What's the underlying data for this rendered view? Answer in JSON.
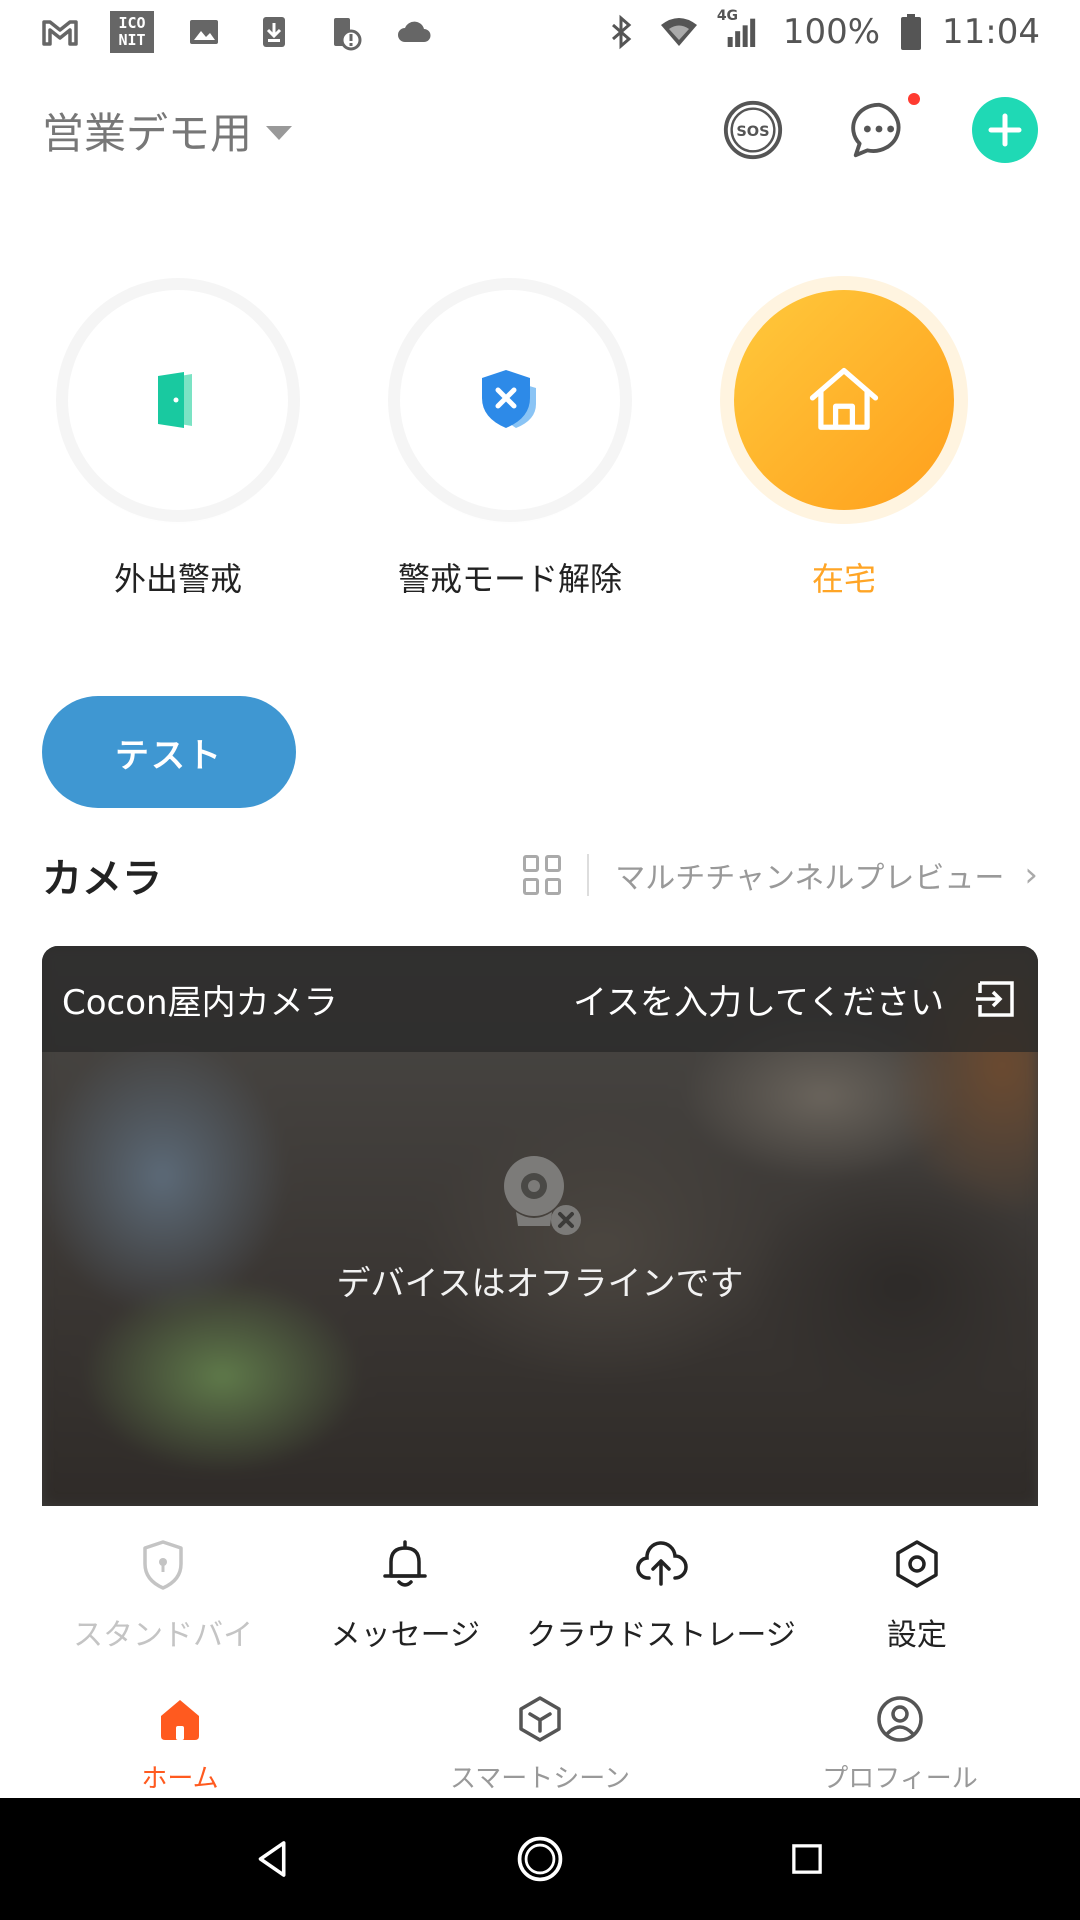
{
  "status_bar": {
    "battery": "100%",
    "time": "11:04",
    "network": "4G",
    "iconit_text": "ICO NIT"
  },
  "header": {
    "home_name": "営業デモ用"
  },
  "modes": [
    {
      "label": "外出警戒",
      "active": false
    },
    {
      "label": "警戒モード解除",
      "active": false
    },
    {
      "label": "在宅",
      "active": true
    }
  ],
  "test_button": "テスト",
  "camera_section": {
    "title": "カメラ",
    "multi_preview": "マルチチャンネルプレビュー"
  },
  "camera_card": {
    "name": "Cocon屋内カメラ",
    "marquee": "イスを入力してください",
    "offline_text": "デバイスはオフラインです"
  },
  "quick_actions": [
    {
      "label": "スタンドバイ",
      "icon": "shield-icon",
      "enabled": false
    },
    {
      "label": "メッセージ",
      "icon": "bell-icon",
      "enabled": true
    },
    {
      "label": "クラウドストレージ",
      "icon": "cloud-upload-icon",
      "enabled": true
    },
    {
      "label": "設定",
      "icon": "gear-icon",
      "enabled": true
    }
  ],
  "tabs": [
    {
      "label": "ホーム",
      "active": true
    },
    {
      "label": "スマートシーン",
      "active": false
    },
    {
      "label": "プロフィール",
      "active": false
    }
  ],
  "colors": {
    "accent_green": "#1fd9b5",
    "active_orange": "#ffa526",
    "test_blue": "#3f97d2",
    "tab_active": "#ff5a1f"
  }
}
